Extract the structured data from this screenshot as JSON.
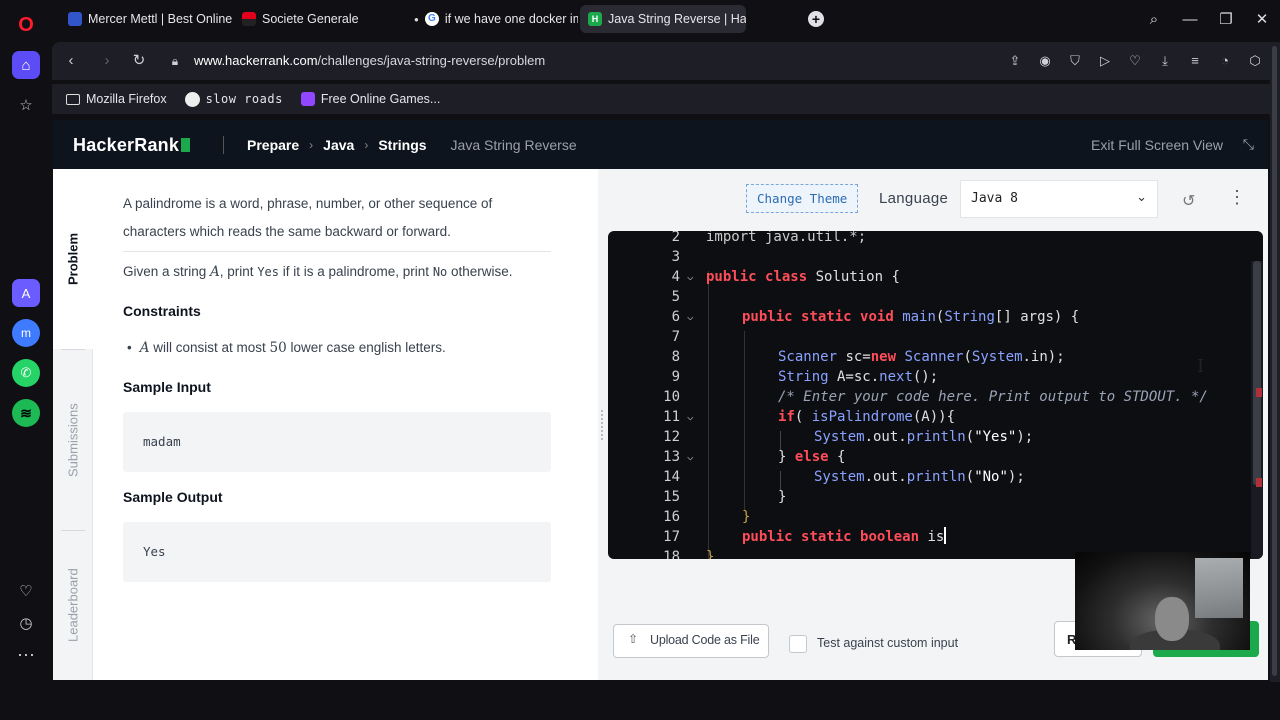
{
  "browser": {
    "tabs": [
      {
        "title": "Mercer Mettl | Best Online",
        "favicon_color": "#3355cc"
      },
      {
        "title": "Societe Generale",
        "favicon_color": "#e3001b"
      },
      {
        "title": "if we have one docker ima",
        "favicon_color": "#4285f4"
      },
      {
        "title": "Java String Reverse | Hack",
        "favicon_color": "#1ba94c",
        "active": true
      }
    ],
    "new_tab_label": "+",
    "url_domain": "www.hackerrank.com",
    "url_path": "/challenges/java-string-reverse/problem",
    "bookmarks": [
      {
        "label": "Mozilla Firefox",
        "icon": "folder-icon"
      },
      {
        "label": "slow roads",
        "icon": "globe-icon"
      },
      {
        "label": "Free Online Games...",
        "icon": "twitch-icon"
      }
    ]
  },
  "header": {
    "logo": "HackerRank",
    "breadcrumb": [
      "Prepare",
      "Java",
      "Strings"
    ],
    "current": "Java String Reverse",
    "exit_fullscreen": "Exit Full Screen View"
  },
  "left_tabs": {
    "problem": "Problem",
    "submissions": "Submissions",
    "leaderboard": "Leaderboard"
  },
  "problem": {
    "intro": "A palindrome is a word, phrase, number, or other sequence of characters which reads the same backward or forward.",
    "task_pre": "Given a string ",
    "task_var": "A",
    "task_mid1": ", print ",
    "task_yes": "Yes",
    "task_mid2": " if it is a palindrome, print ",
    "task_no": "No",
    "task_post": " otherwise.",
    "constraints_heading": "Constraints",
    "constraint_var": "A",
    "constraint_pre": " will consist at most ",
    "constraint_num": "50",
    "constraint_post": " lower case english letters.",
    "sample_input_heading": "Sample Input",
    "sample_input": "madam",
    "sample_output_heading": "Sample Output",
    "sample_output": "Yes"
  },
  "editor": {
    "change_theme": "Change Theme",
    "language_label": "Language",
    "language_value": "Java 8",
    "upload_label": "Upload Code as File",
    "custom_input_label": "Test against custom input",
    "run_label": "R"
  },
  "code_lines": [
    {
      "n": "2",
      "text": "import java.util.*;"
    },
    {
      "n": "3",
      "text": ""
    },
    {
      "n": "4",
      "text": "public class Solution {"
    },
    {
      "n": "5",
      "text": ""
    },
    {
      "n": "6",
      "text": "public static void main(String[] args) {"
    },
    {
      "n": "7",
      "text": ""
    },
    {
      "n": "8",
      "text": "Scanner sc=new Scanner(System.in);"
    },
    {
      "n": "9",
      "text": "String A=sc.next();"
    },
    {
      "n": "10",
      "text": "/* Enter your code here. Print output to STDOUT. */"
    },
    {
      "n": "11",
      "text": "if( isPalindrome(A)){"
    },
    {
      "n": "12",
      "text": "System.out.println(\"Yes\");"
    },
    {
      "n": "13",
      "text": "} else {"
    },
    {
      "n": "14",
      "text": "System.out.println(\"No\");"
    },
    {
      "n": "15",
      "text": "}"
    },
    {
      "n": "16",
      "text": "}"
    },
    {
      "n": "17",
      "text": "public static boolean is"
    },
    {
      "n": "18",
      "text": "}"
    }
  ]
}
